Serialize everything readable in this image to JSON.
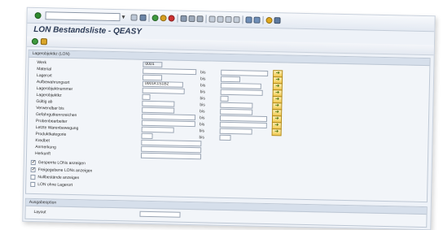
{
  "window": {
    "title": "LON Bestandsliste - QEASY"
  },
  "toolbar": {
    "icons": [
      "ok-icon",
      "back-icon",
      "save-icon",
      "nav-back-icon",
      "exit-icon",
      "cancel-icon",
      "print-icon",
      "find-icon",
      "find-next-icon",
      "first-page-icon",
      "prev-page-icon",
      "next-page-icon",
      "last-page-icon",
      "new-session-icon",
      "shortcut-icon",
      "help-icon",
      "layout-icon"
    ]
  },
  "appbar": {
    "icons": [
      "execute-icon",
      "get-variant-icon"
    ]
  },
  "selection_group": {
    "header": "Lagerobjektkz (LON)",
    "to_label": "bis",
    "rows": [
      {
        "label": "Werk",
        "value": "0001"
      },
      {
        "label": "Material",
        "value": ""
      },
      {
        "label": "Lagerort",
        "value": ""
      },
      {
        "label": "Aufbewahrungsort",
        "value": "0001K1S1B2"
      },
      {
        "label": "Lagerobjektnummer",
        "value": ""
      },
      {
        "label": "Lagerobjektkz",
        "value": ""
      },
      {
        "label": "Gültig ab",
        "value": ""
      },
      {
        "label": "Verwendbar bis",
        "value": ""
      },
      {
        "label": "Gefahrgutkennzeichen",
        "value": ""
      },
      {
        "label": "Probenbearbeiter",
        "value": ""
      },
      {
        "label": "Letzte Warenbewegung",
        "value": ""
      },
      {
        "label": "Produktkategorie",
        "value": ""
      },
      {
        "label": "Kredbet",
        "value": ""
      },
      {
        "label": "Anmerkung",
        "value": ""
      },
      {
        "label": "Herkunft",
        "value": ""
      }
    ],
    "checkboxes": [
      {
        "label": "Gesperrte LONs anzeigen",
        "checked": "✓"
      },
      {
        "label": "Freigegebene LONs anzeigen",
        "checked": "✓"
      },
      {
        "label": "Nullbestände anzeigen",
        "checked": ""
      },
      {
        "label": "LON ohne Lagerort",
        "checked": ""
      }
    ]
  },
  "output_group": {
    "header": "Ausgabeoption",
    "layout_label": "Layout",
    "layout_value": ""
  },
  "colors": {
    "accent": "#2b3a55",
    "select_button": "#f0c84e"
  }
}
